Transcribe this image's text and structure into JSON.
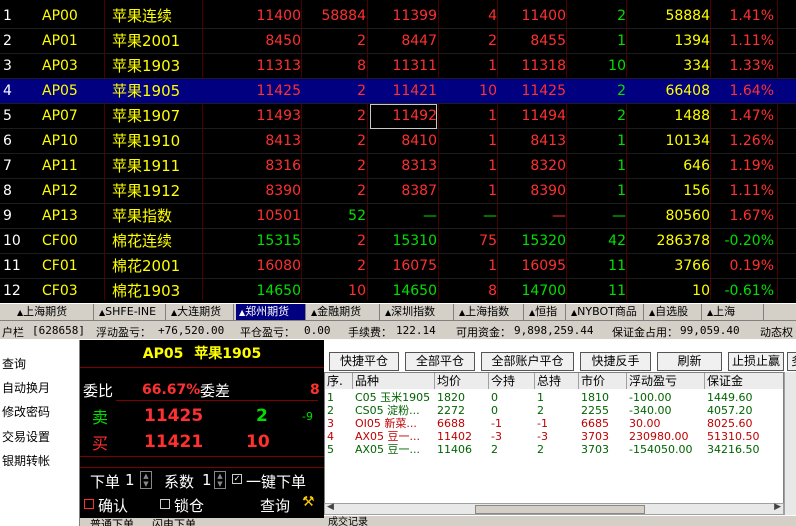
{
  "quote_rows": [
    {
      "idx": "1",
      "code": "AP00",
      "name": "苹果连续",
      "last": "11400",
      "vol": "58884",
      "bid": "11399",
      "bidv": "4",
      "ask": "11400",
      "askv": "2",
      "oi": "58884",
      "chg": "1.41%",
      "last_c": "red",
      "bid_c": "red",
      "ask_c": "red",
      "chg_c": "red"
    },
    {
      "idx": "2",
      "code": "AP01",
      "name": "苹果2001",
      "last": "8450",
      "vol": "2",
      "bid": "8447",
      "bidv": "2",
      "ask": "8455",
      "askv": "1",
      "oi": "1394",
      "chg": "1.11%",
      "last_c": "red",
      "bid_c": "red",
      "ask_c": "red",
      "chg_c": "red"
    },
    {
      "idx": "3",
      "code": "AP03",
      "name": "苹果1903",
      "last": "11313",
      "vol": "8",
      "bid": "11311",
      "bidv": "1",
      "ask": "11318",
      "askv": "10",
      "oi": "334",
      "chg": "1.33%",
      "last_c": "red",
      "bid_c": "red",
      "ask_c": "red",
      "chg_c": "red"
    },
    {
      "idx": "4",
      "code": "AP05",
      "name": "苹果1905",
      "last": "11425",
      "vol": "2",
      "bid": "11421",
      "bidv": "10",
      "ask": "11425",
      "askv": "2",
      "oi": "66408",
      "chg": "1.64%",
      "last_c": "red",
      "bid_c": "red",
      "ask_c": "red",
      "chg_c": "red"
    },
    {
      "idx": "5",
      "code": "AP07",
      "name": "苹果1907",
      "last": "11493",
      "vol": "2",
      "bid": "11492",
      "bidv": "1",
      "ask": "11494",
      "askv": "2",
      "oi": "1488",
      "chg": "1.47%",
      "last_c": "red",
      "bid_c": "red",
      "ask_c": "red",
      "chg_c": "red"
    },
    {
      "idx": "6",
      "code": "AP10",
      "name": "苹果1910",
      "last": "8413",
      "vol": "2",
      "bid": "8410",
      "bidv": "1",
      "ask": "8413",
      "askv": "1",
      "oi": "10134",
      "chg": "1.26%",
      "last_c": "red",
      "bid_c": "red",
      "ask_c": "red",
      "chg_c": "red"
    },
    {
      "idx": "7",
      "code": "AP11",
      "name": "苹果1911",
      "last": "8316",
      "vol": "2",
      "bid": "8313",
      "bidv": "1",
      "ask": "8320",
      "askv": "1",
      "oi": "646",
      "chg": "1.19%",
      "last_c": "red",
      "bid_c": "red",
      "ask_c": "red",
      "chg_c": "red"
    },
    {
      "idx": "8",
      "code": "AP12",
      "name": "苹果1912",
      "last": "8390",
      "vol": "2",
      "bid": "8387",
      "bidv": "1",
      "ask": "8390",
      "askv": "1",
      "oi": "156",
      "chg": "1.11%",
      "last_c": "red",
      "bid_c": "red",
      "ask_c": "red",
      "chg_c": "red"
    },
    {
      "idx": "9",
      "code": "AP13",
      "name": "苹果指数",
      "last": "10501",
      "vol": "52",
      "bid": "—",
      "bidv": "—",
      "ask": "—",
      "askv": "—",
      "oi": "80560",
      "chg": "1.67%",
      "last_c": "red",
      "bid_c": "grn",
      "ask_c": "red",
      "chg_c": "red"
    },
    {
      "idx": "10",
      "code": "CF00",
      "name": "棉花连续",
      "last": "15315",
      "vol": "2",
      "bid": "15310",
      "bidv": "75",
      "ask": "15320",
      "askv": "42",
      "oi": "286378",
      "chg": "-0.20%",
      "last_c": "grn",
      "bid_c": "grn",
      "ask_c": "grn",
      "chg_c": "grn"
    },
    {
      "idx": "11",
      "code": "CF01",
      "name": "棉花2001",
      "last": "16080",
      "vol": "2",
      "bid": "16075",
      "bidv": "1",
      "ask": "16095",
      "askv": "11",
      "oi": "3766",
      "chg": "0.19%",
      "last_c": "red",
      "bid_c": "red",
      "ask_c": "red",
      "chg_c": "red"
    },
    {
      "idx": "12",
      "code": "CF03",
      "name": "棉花1903",
      "last": "14650",
      "vol": "10",
      "bid": "14650",
      "bidv": "8",
      "ask": "14700",
      "askv": "11",
      "oi": "10",
      "chg": "-0.61%",
      "last_c": "grn",
      "bid_c": "grn",
      "ask_c": "grn",
      "chg_c": "grn"
    }
  ],
  "market_tabs": [
    "上海期货",
    "SHFE-INE",
    "大连期货",
    "郑州期货",
    "金融期货",
    "深圳指数",
    "上海指数",
    "恒指",
    "NYBOT商品",
    "自选股",
    "上海"
  ],
  "account": {
    "label": "户栏",
    "id": "[628658]",
    "float_pl_label": "浮动盈亏：",
    "float_pl": "+76,520.00",
    "close_pl_label": "平仓盈亏：",
    "close_pl": "0.00",
    "fee_label": "手续费：",
    "fee": "122.14",
    "avail_label": "可用资金：",
    "avail": "9,898,259.44",
    "margin_label": "保证金占用：",
    "margin": "99,059.40",
    "dyn_label": "动态权"
  },
  "left_menu": [
    "查询",
    "自动换月",
    "修改密码",
    "交易设置",
    "银期转帐"
  ],
  "order_panel": {
    "title_code": "AP05",
    "title_name": "苹果1905",
    "ratio_label": "委比",
    "ratio": "66.67%",
    "diff_label": "委差",
    "diff": "8",
    "sell_label": "卖",
    "sell_price": "11425",
    "sell_vol": "2",
    "sell_chg": "-9",
    "buy_label": "买",
    "buy_price": "11421",
    "buy_vol": "10",
    "order_label": "下单",
    "order_qty": "1",
    "coef_label": "系数",
    "coef": "1",
    "one_key_label": "一键下单",
    "confirm_label": "确认",
    "lock_label": "锁仓",
    "query_label": "查询",
    "bottom_tabs": [
      "普通下单",
      "闪电下单"
    ]
  },
  "toolbar_buttons": [
    "快捷平仓",
    "全部平仓",
    "全部账户平仓",
    "快捷反手",
    "刷新",
    "止损止赢",
    "多"
  ],
  "positions": {
    "headers": [
      "序.",
      "品种",
      "均价",
      "今持",
      "总持",
      "市价",
      "浮动盈亏",
      "保证金"
    ],
    "rows": [
      {
        "cells": [
          "1",
          "C05 玉米1905",
          "1820",
          "0",
          "1",
          "1810",
          "-100.00",
          "1449.60"
        ],
        "color": "#006400",
        "underline": false
      },
      {
        "cells": [
          "2",
          "CS05 淀粉...",
          "2272",
          "0",
          "2",
          "2255",
          "-340.00",
          "4057.20"
        ],
        "color": "#006400",
        "underline": false
      },
      {
        "cells": [
          "3",
          "OI05 新菜...",
          "6688",
          "-1",
          "-1",
          "6685",
          "30.00",
          "8025.60"
        ],
        "color": "#c00000",
        "underline": false
      },
      {
        "cells": [
          "4",
          "AX05 豆一...",
          "11402",
          "-3",
          "-3",
          "3703",
          "230980.00",
          "51310.50"
        ],
        "color": "#c00000",
        "underline": true
      },
      {
        "cells": [
          "5",
          "AX05 豆一...",
          "11406",
          "2",
          "2",
          "3703",
          "-154050.00",
          "34216.50"
        ],
        "color": "#006400",
        "underline": true
      }
    ]
  },
  "bottom_tab": "成交记录"
}
